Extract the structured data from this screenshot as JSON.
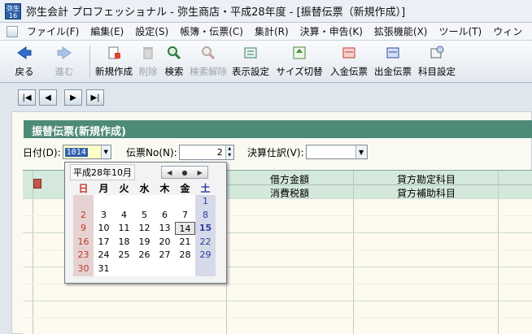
{
  "app": {
    "icon_text": "弥生16",
    "title": "弥生会計 プロフェッショナル - 弥生商店・平成28年度 - [振替伝票（新規作成）]"
  },
  "menu": [
    "ファイル(F)",
    "編集(E)",
    "設定(S)",
    "帳簿・伝票(C)",
    "集計(R)",
    "決算・申告(K)",
    "拡張機能(X)",
    "ツール(T)",
    "ウィン"
  ],
  "toolbar": [
    {
      "label": "戻る",
      "icon": "back-arrow-icon",
      "enabled": true
    },
    {
      "label": "進む",
      "icon": "forward-arrow-icon",
      "enabled": false
    },
    {
      "label": "新規作成",
      "icon": "new-document-icon",
      "enabled": true
    },
    {
      "label": "削除",
      "icon": "trash-icon",
      "enabled": false
    },
    {
      "label": "検索",
      "icon": "magnifier-icon",
      "enabled": true
    },
    {
      "label": "検索解除",
      "icon": "clear-search-icon",
      "enabled": false
    },
    {
      "label": "表示設定",
      "icon": "display-settings-icon",
      "enabled": true
    },
    {
      "label": "サイズ切替",
      "icon": "resize-icon",
      "enabled": true
    },
    {
      "label": "入金伝票",
      "icon": "deposit-slip-icon",
      "enabled": true
    },
    {
      "label": "出金伝票",
      "icon": "payment-slip-icon",
      "enabled": true
    },
    {
      "label": "科目設定",
      "icon": "account-settings-icon",
      "enabled": true
    }
  ],
  "nav_buttons": [
    "|◀",
    "◀",
    "▶",
    "▶|"
  ],
  "form": {
    "header": "振替伝票(新規作成)",
    "date_label": "日付(D):",
    "date_value": "1014",
    "slip_label": "伝票No(N):",
    "slip_value": "2",
    "closing_label": "決算仕訳(V):",
    "closing_value": ""
  },
  "grid": {
    "col_debit_amount": "借方金額",
    "col_tax": "消費税額",
    "col_credit_account": "貸方勘定科目",
    "col_credit_sub": "貸方補助科目"
  },
  "calendar": {
    "month_label": "平成28年10月",
    "nav": [
      "◀",
      "●",
      "▶"
    ],
    "weekdays": [
      "日",
      "月",
      "火",
      "水",
      "木",
      "金",
      "土"
    ],
    "weeks": [
      [
        "",
        "",
        "",
        "",
        "",
        "",
        "1"
      ],
      [
        "2",
        "3",
        "4",
        "5",
        "6",
        "7",
        "8"
      ],
      [
        "9",
        "10",
        "11",
        "12",
        "13",
        "14",
        "15"
      ],
      [
        "16",
        "17",
        "18",
        "19",
        "20",
        "21",
        "22"
      ],
      [
        "23",
        "24",
        "25",
        "26",
        "27",
        "28",
        "29"
      ],
      [
        "30",
        "31",
        "",
        "",
        "",
        "",
        ""
      ]
    ],
    "today": "14",
    "selected": "15"
  },
  "colors": {
    "header_green": "#4d8a78",
    "grid_head": "#d5e8dc",
    "selection_blue": "#2f5fb0",
    "sunday": "#c0392b",
    "saturday": "#2c3e9a"
  }
}
